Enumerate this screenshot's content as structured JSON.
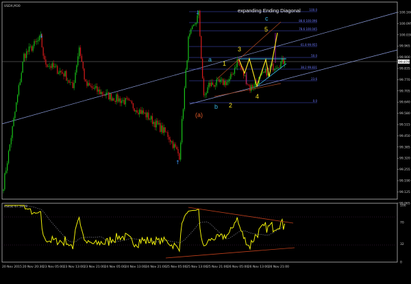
{
  "window": {
    "symbol_label": "USDX,M30",
    "indicator_label": "RSI(8) 67.5979"
  },
  "colors": {
    "bull": "#19c819",
    "bear": "#e01c1c",
    "rsi": "#f2f20a",
    "trendline": "#8fa0e0",
    "wave_yellow": "#f5e020",
    "wave_cyan": "#3ab8e6",
    "wave_orange": "#e05a28",
    "channel": "#b04a20",
    "fib": "#4a55d8",
    "arrow": "#3a8ee8"
  },
  "annotations": {
    "title": "expanding Ending Diagonal",
    "waves": {
      "a": "a",
      "b": "b",
      "c": "c",
      "a_paren": "(a)",
      "w1": "1",
      "w2": "2",
      "w3": "3",
      "w4": "4",
      "w5": "5"
    },
    "fib_levels": [
      "100.0",
      "88.6 100.096",
      "78.6 100.045",
      "61.8 99.955",
      "50.0",
      "38.2 99.831",
      "23.6",
      "0.0"
    ]
  },
  "chart_data": {
    "type": "candlestick",
    "timeframe": "M30",
    "price_axis": {
      "ticks": [
        "100.160",
        "100.095",
        "100.030",
        "99.965",
        "99.900",
        "99.835",
        "99.770",
        "99.705",
        "99.640",
        "99.580",
        "99.515",
        "99.450",
        "99.385",
        "99.320",
        "99.255",
        "99.190",
        "99.125",
        "99.065"
      ],
      "current_price": "99.879",
      "ylim": [
        99.05,
        100.17
      ]
    },
    "time_axis": {
      "ticks": [
        "20 Nov 2015",
        "20 Nov 20:30",
        "23 Nov 05:00",
        "23 Nov 13:00",
        "23 Nov 21:00",
        "24 Nov 05:00",
        "24 Nov 13:00",
        "24 Nov 21:00",
        "25 Nov 05:00",
        "25 Nov 13:00",
        "25 Nov 21:00",
        "26 Nov 05:00",
        "26 Nov 13:00",
        "26 Nov 21:00"
      ]
    },
    "price_path": [
      {
        "time": "20 Nov 12:30",
        "close": 99.16
      },
      {
        "time": "20 Nov 14:00",
        "close": 99.3
      },
      {
        "time": "20 Nov 20:30",
        "close": 99.91
      },
      {
        "time": "23 Nov 03:30",
        "close": 100.01
      },
      {
        "time": "23 Nov 05:00",
        "close": 99.87
      },
      {
        "time": "23 Nov 13:00",
        "close": 99.8
      },
      {
        "time": "23 Nov 16:00",
        "close": 99.72
      },
      {
        "time": "23 Nov 18:30",
        "close": 99.96
      },
      {
        "time": "23 Nov 21:00",
        "close": 99.74
      },
      {
        "time": "24 Nov 05:00",
        "close": 99.68
      },
      {
        "time": "24 Nov 13:00",
        "close": 99.64
      },
      {
        "time": "24 Nov 21:00",
        "close": 99.56
      },
      {
        "time": "25 Nov 05:00",
        "close": 99.45
      },
      {
        "time": "25 Nov 09:30",
        "close": 99.33
      },
      {
        "time": "25 Nov 13:00",
        "close": 100.0
      },
      {
        "time": "25 Nov 17:00",
        "close": 100.15
      },
      {
        "time": "25 Nov 19:00",
        "close": 99.66
      },
      {
        "time": "25 Nov 21:00",
        "close": 99.74
      },
      {
        "time": "26 Nov 05:00",
        "close": 99.76
      },
      {
        "time": "26 Nov 08:00",
        "close": 99.88
      },
      {
        "time": "26 Nov 13:00",
        "close": 99.72
      },
      {
        "time": "26 Nov 21:00",
        "close": 99.84
      },
      {
        "time": "27 Nov 02:30",
        "close": 99.879
      }
    ],
    "rsi": {
      "period": 8,
      "last": 67.5979,
      "levels": [
        "100",
        "70",
        "32",
        "0"
      ],
      "ylim": [
        0,
        100
      ]
    }
  }
}
